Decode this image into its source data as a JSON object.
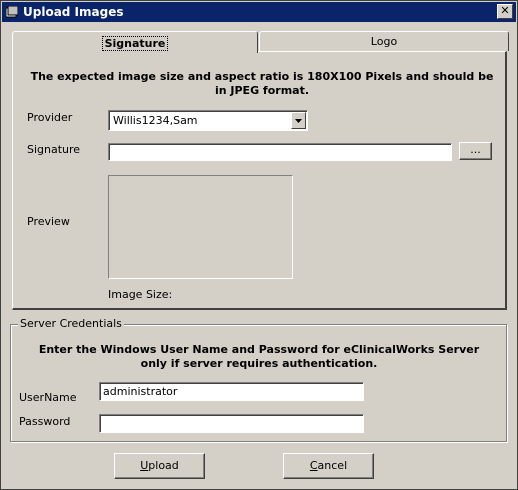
{
  "window": {
    "title": "Upload Images",
    "close_glyph": "✕"
  },
  "tabs": [
    {
      "label": "Signature",
      "active": true
    },
    {
      "label": "Logo",
      "active": false
    }
  ],
  "signature_tab": {
    "info_text": "The expected image size and aspect ratio is 180X100 Pixels and should be in JPEG format.",
    "provider_label": "Provider",
    "provider_value": "Willis1234,Sam",
    "signature_label": "Signature",
    "signature_value": "",
    "browse_label": "...",
    "preview_label": "Preview",
    "image_size_label": "Image Size:"
  },
  "server_credentials": {
    "group_title": "Server Credentials",
    "info_text": "Enter the Windows User Name and Password for eClinicalWorks Server only if server requires authentication.",
    "username_label": "UserName",
    "username_value": "administrator",
    "password_label": "Password",
    "password_value": ""
  },
  "buttons": {
    "upload_mnemonic": "U",
    "upload_rest": "pload",
    "cancel_mnemonic": "C",
    "cancel_rest": "ancel"
  },
  "colors": {
    "title_bar": "#0a246a",
    "face": "#d4d0c8"
  }
}
